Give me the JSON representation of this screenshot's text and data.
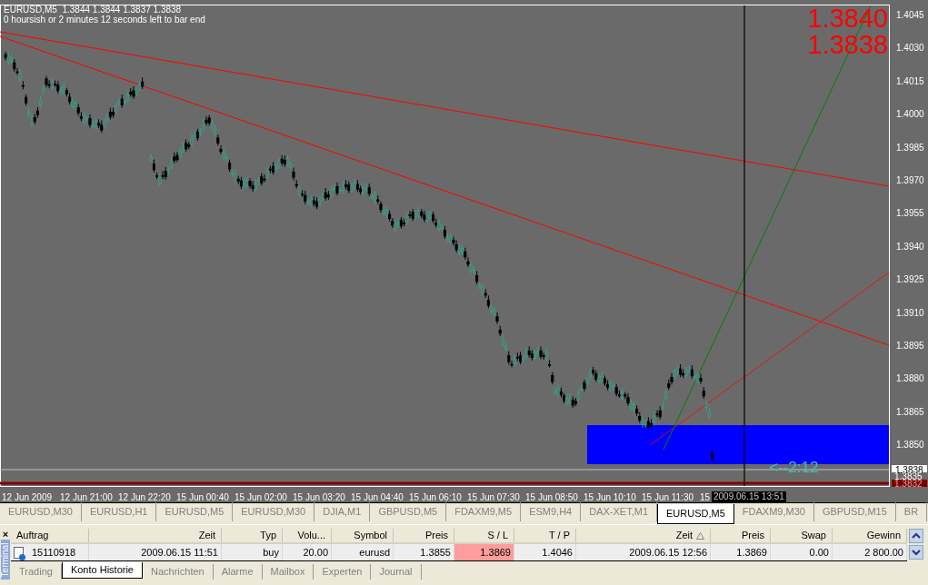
{
  "chart": {
    "header": "EURUSD,M5  1.3844 1.3844 1.3837 1.3838",
    "countdown": "0 hoursish or 2 minutes 12 seconds left to bar end",
    "big_prices": [
      "1.3840",
      "1.3838"
    ],
    "timer_label": "<--2:12",
    "cursor_time": "2009.06.15 13:51",
    "price_ticks": [
      "1.4045",
      "1.4030",
      "1.4015",
      "1.4000",
      "1.3985",
      "1.3970",
      "1.3955",
      "1.3940",
      "1.3925",
      "1.3910",
      "1.3895",
      "1.3880",
      "1.3865",
      "1.3850"
    ],
    "time_ticks": [
      "12 Jun 2009",
      "12 Jun 21:00",
      "12 Jun 22:20",
      "15 Jun 00:40",
      "15 Jun 02:00",
      "15 Jun 03:20",
      "15 Jun 04:40",
      "15 Jun 06:10",
      "15 Jun 07:30",
      "15 Jun 08:50",
      "15 Jun 10:10",
      "15 Jun 11:30",
      "15"
    ],
    "price_markers": [
      {
        "text": "1.3838",
        "kind": "bid"
      },
      {
        "text": "1.3835",
        "kind": "plain"
      },
      {
        "text": "1.3832",
        "kind": "ask"
      }
    ]
  },
  "chart_tabs": [
    {
      "label": "EURUSD,M30",
      "selected": false
    },
    {
      "label": "EURUSD,H1",
      "selected": false
    },
    {
      "label": "EURUSD,M5",
      "selected": false
    },
    {
      "label": "EURUSD,M30",
      "selected": false
    },
    {
      "label": "DJIA,M1",
      "selected": false
    },
    {
      "label": "GBPUSD,M5",
      "selected": false
    },
    {
      "label": "FDAXM9,M5",
      "selected": false
    },
    {
      "label": "ESM9,H4",
      "selected": false
    },
    {
      "label": "DAX-XET,M1",
      "selected": false
    },
    {
      "label": "EURUSD,M5",
      "selected": true
    },
    {
      "label": "FDAXM9,M30",
      "selected": false
    },
    {
      "label": "GBPUSD,M15",
      "selected": false
    },
    {
      "label": "BR",
      "selected": false
    }
  ],
  "terminal": {
    "side_label": "Terminal",
    "close": "×",
    "columns": [
      {
        "label": "Auftrag",
        "sorted": false
      },
      {
        "label": "Zeit",
        "sorted": false
      },
      {
        "label": "Typ",
        "sorted": false
      },
      {
        "label": "Volu...",
        "sorted": false
      },
      {
        "label": "Symbol",
        "sorted": false
      },
      {
        "label": "Preis",
        "sorted": false
      },
      {
        "label": "S / L",
        "sorted": false
      },
      {
        "label": "T / P",
        "sorted": false
      },
      {
        "label": "Zeit",
        "sorted": true
      },
      {
        "label": "Preis",
        "sorted": false
      },
      {
        "label": "Swap",
        "sorted": false
      },
      {
        "label": "Gewinn",
        "sorted": false
      }
    ],
    "rows": [
      {
        "cells": [
          {
            "text": "15110918",
            "highlighted": false
          },
          {
            "text": "2009.06.15 11:51",
            "highlighted": false
          },
          {
            "text": "buy",
            "highlighted": false
          },
          {
            "text": "20.00",
            "highlighted": false
          },
          {
            "text": "eurusd",
            "highlighted": false
          },
          {
            "text": "1.3855",
            "highlighted": false
          },
          {
            "text": "1.3869",
            "highlighted": true
          },
          {
            "text": "1.4046",
            "highlighted": false
          },
          {
            "text": "2009.06.15 12:56",
            "highlighted": false
          },
          {
            "text": "1.3869",
            "highlighted": false
          },
          {
            "text": "0.00",
            "highlighted": false
          },
          {
            "text": "2 800.00",
            "highlighted": false
          }
        ]
      }
    ],
    "tabs": [
      {
        "label": "Trading",
        "selected": false
      },
      {
        "label": "Konto Historie",
        "selected": true
      },
      {
        "label": "Nachrichten",
        "selected": false
      },
      {
        "label": "Alarme",
        "selected": false
      },
      {
        "label": "Mailbox",
        "selected": false
      },
      {
        "label": "Experten",
        "selected": false
      },
      {
        "label": "Journal",
        "selected": false
      }
    ]
  }
}
